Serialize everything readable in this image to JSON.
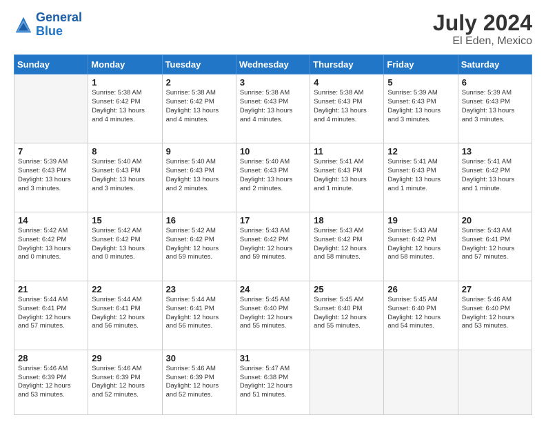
{
  "header": {
    "logo_line1": "General",
    "logo_line2": "Blue",
    "month_year": "July 2024",
    "location": "El Eden, Mexico"
  },
  "columns": [
    "Sunday",
    "Monday",
    "Tuesday",
    "Wednesday",
    "Thursday",
    "Friday",
    "Saturday"
  ],
  "weeks": [
    [
      {
        "day": "",
        "content": ""
      },
      {
        "day": "1",
        "content": "Sunrise: 5:38 AM\nSunset: 6:42 PM\nDaylight: 13 hours\nand 4 minutes."
      },
      {
        "day": "2",
        "content": "Sunrise: 5:38 AM\nSunset: 6:42 PM\nDaylight: 13 hours\nand 4 minutes."
      },
      {
        "day": "3",
        "content": "Sunrise: 5:38 AM\nSunset: 6:43 PM\nDaylight: 13 hours\nand 4 minutes."
      },
      {
        "day": "4",
        "content": "Sunrise: 5:38 AM\nSunset: 6:43 PM\nDaylight: 13 hours\nand 4 minutes."
      },
      {
        "day": "5",
        "content": "Sunrise: 5:39 AM\nSunset: 6:43 PM\nDaylight: 13 hours\nand 3 minutes."
      },
      {
        "day": "6",
        "content": "Sunrise: 5:39 AM\nSunset: 6:43 PM\nDaylight: 13 hours\nand 3 minutes."
      }
    ],
    [
      {
        "day": "7",
        "content": "Sunrise: 5:39 AM\nSunset: 6:43 PM\nDaylight: 13 hours\nand 3 minutes."
      },
      {
        "day": "8",
        "content": "Sunrise: 5:40 AM\nSunset: 6:43 PM\nDaylight: 13 hours\nand 3 minutes."
      },
      {
        "day": "9",
        "content": "Sunrise: 5:40 AM\nSunset: 6:43 PM\nDaylight: 13 hours\nand 2 minutes."
      },
      {
        "day": "10",
        "content": "Sunrise: 5:40 AM\nSunset: 6:43 PM\nDaylight: 13 hours\nand 2 minutes."
      },
      {
        "day": "11",
        "content": "Sunrise: 5:41 AM\nSunset: 6:43 PM\nDaylight: 13 hours\nand 1 minute."
      },
      {
        "day": "12",
        "content": "Sunrise: 5:41 AM\nSunset: 6:43 PM\nDaylight: 13 hours\nand 1 minute."
      },
      {
        "day": "13",
        "content": "Sunrise: 5:41 AM\nSunset: 6:42 PM\nDaylight: 13 hours\nand 1 minute."
      }
    ],
    [
      {
        "day": "14",
        "content": "Sunrise: 5:42 AM\nSunset: 6:42 PM\nDaylight: 13 hours\nand 0 minutes."
      },
      {
        "day": "15",
        "content": "Sunrise: 5:42 AM\nSunset: 6:42 PM\nDaylight: 13 hours\nand 0 minutes."
      },
      {
        "day": "16",
        "content": "Sunrise: 5:42 AM\nSunset: 6:42 PM\nDaylight: 12 hours\nand 59 minutes."
      },
      {
        "day": "17",
        "content": "Sunrise: 5:43 AM\nSunset: 6:42 PM\nDaylight: 12 hours\nand 59 minutes."
      },
      {
        "day": "18",
        "content": "Sunrise: 5:43 AM\nSunset: 6:42 PM\nDaylight: 12 hours\nand 58 minutes."
      },
      {
        "day": "19",
        "content": "Sunrise: 5:43 AM\nSunset: 6:42 PM\nDaylight: 12 hours\nand 58 minutes."
      },
      {
        "day": "20",
        "content": "Sunrise: 5:43 AM\nSunset: 6:41 PM\nDaylight: 12 hours\nand 57 minutes."
      }
    ],
    [
      {
        "day": "21",
        "content": "Sunrise: 5:44 AM\nSunset: 6:41 PM\nDaylight: 12 hours\nand 57 minutes."
      },
      {
        "day": "22",
        "content": "Sunrise: 5:44 AM\nSunset: 6:41 PM\nDaylight: 12 hours\nand 56 minutes."
      },
      {
        "day": "23",
        "content": "Sunrise: 5:44 AM\nSunset: 6:41 PM\nDaylight: 12 hours\nand 56 minutes."
      },
      {
        "day": "24",
        "content": "Sunrise: 5:45 AM\nSunset: 6:40 PM\nDaylight: 12 hours\nand 55 minutes."
      },
      {
        "day": "25",
        "content": "Sunrise: 5:45 AM\nSunset: 6:40 PM\nDaylight: 12 hours\nand 55 minutes."
      },
      {
        "day": "26",
        "content": "Sunrise: 5:45 AM\nSunset: 6:40 PM\nDaylight: 12 hours\nand 54 minutes."
      },
      {
        "day": "27",
        "content": "Sunrise: 5:46 AM\nSunset: 6:40 PM\nDaylight: 12 hours\nand 53 minutes."
      }
    ],
    [
      {
        "day": "28",
        "content": "Sunrise: 5:46 AM\nSunset: 6:39 PM\nDaylight: 12 hours\nand 53 minutes."
      },
      {
        "day": "29",
        "content": "Sunrise: 5:46 AM\nSunset: 6:39 PM\nDaylight: 12 hours\nand 52 minutes."
      },
      {
        "day": "30",
        "content": "Sunrise: 5:46 AM\nSunset: 6:39 PM\nDaylight: 12 hours\nand 52 minutes."
      },
      {
        "day": "31",
        "content": "Sunrise: 5:47 AM\nSunset: 6:38 PM\nDaylight: 12 hours\nand 51 minutes."
      },
      {
        "day": "",
        "content": ""
      },
      {
        "day": "",
        "content": ""
      },
      {
        "day": "",
        "content": ""
      }
    ]
  ]
}
